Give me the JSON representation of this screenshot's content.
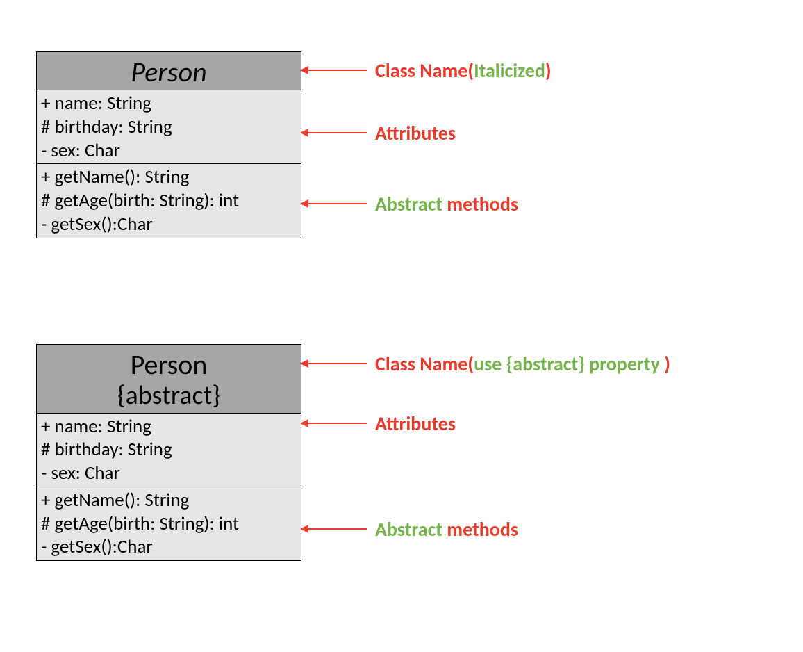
{
  "colors": {
    "red": "#e93a2a",
    "green": "#74b44a",
    "header_bg": "#a6a6a6",
    "body_bg": "#e6e6e6"
  },
  "uml1": {
    "name": "Person",
    "name_italic": true,
    "tag": "",
    "attributes": [
      "+ name: String",
      "# birthday: String",
      "-  sex: Char"
    ],
    "methods": [
      "+ getName(): String",
      "# getAge(birth: String): int",
      "-  getSex():Char"
    ]
  },
  "uml2": {
    "name": "Person",
    "name_italic": false,
    "tag": "{abstract}",
    "attributes": [
      "+ name: String",
      "# birthday: String",
      "-  sex: Char"
    ],
    "methods": [
      "+ getName(): String",
      "# getAge(birth: String): int",
      "-  getSex():Char"
    ]
  },
  "annotations": {
    "a1_class": {
      "t1": "Class Name(",
      "t2": "Italicized",
      "t3": ")"
    },
    "a1_attrs": {
      "t1": "Attributes"
    },
    "a1_methods": {
      "t1": "Abstract",
      "t2": " methods"
    },
    "a2_class": {
      "t1": "Class Name(",
      "t2": "use {abstract} property ",
      "t3": ")"
    },
    "a2_attrs": {
      "t1": "Attributes"
    },
    "a2_methods": {
      "t1": "Abstract",
      "t2": " methods"
    }
  }
}
